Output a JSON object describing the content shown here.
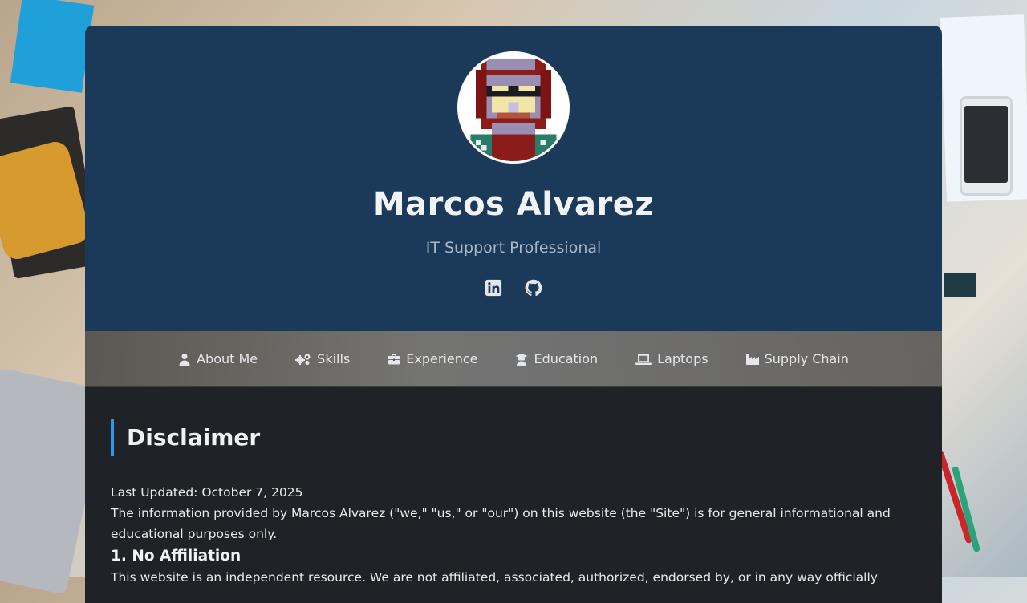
{
  "profile": {
    "name": "Marcos Alvarez",
    "title": "IT Support Professional"
  },
  "social": [
    {
      "icon": "linkedin-icon"
    },
    {
      "icon": "github-icon"
    }
  ],
  "nav": {
    "items": [
      {
        "label": "About Me",
        "icon": "user-icon"
      },
      {
        "label": "Skills",
        "icon": "gears-icon"
      },
      {
        "label": "Experience",
        "icon": "briefcase-icon"
      },
      {
        "label": "Education",
        "icon": "graduation-icon"
      },
      {
        "label": "Laptops",
        "icon": "laptop-icon"
      },
      {
        "label": "Supply Chain",
        "icon": "industry-icon"
      }
    ]
  },
  "disclaimer": {
    "heading": "Disclaimer",
    "updated": "Last Updated: October 7, 2025",
    "intro": "The information provided by Marcos Alvarez (\"we,\" \"us,\" or \"our\") on this website (the \"Site\") is for general informational and educational purposes only.",
    "section1_title": "1. No Affiliation",
    "section1_text": "This website is an independent resource. We are not affiliated, associated, authorized, endorsed by, or in any way officially"
  },
  "colors": {
    "hero_bg": "#1b3a5a",
    "content_bg": "#1f2227",
    "accent": "#2f95e8"
  }
}
